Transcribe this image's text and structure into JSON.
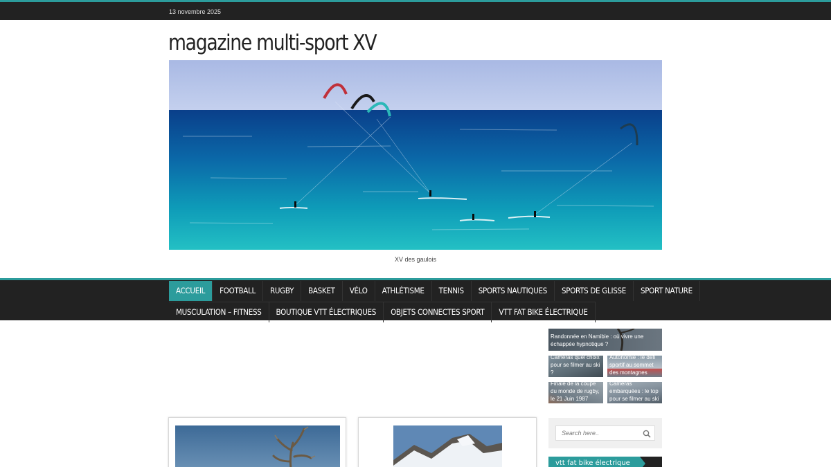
{
  "topbar": {
    "date": "13 novembre 2025"
  },
  "site": {
    "title": "magazine multi-sport XV",
    "hero_caption": "XV des gaulois"
  },
  "nav": {
    "row1": [
      "ACCUEIL",
      "FOOTBALL",
      "RUGBY",
      "BASKET",
      "VÉLO",
      "ATHLÉTISME",
      "TENNIS",
      "SPORTS NAUTIQUES",
      "SPORTS DE GLISSE",
      "SPORT NATURE"
    ],
    "row2": [
      "MUSCULATION – FITNESS",
      "BOUTIQUE VTT ÉLECTRIQUES",
      "OBJETS CONNECTES SPORT",
      "VTT FAT BIKE ÉLECTRIQUE"
    ],
    "active": "ACCUEIL"
  },
  "slider": {
    "main": "Randonnée en Namibie : où vivre une échappée hypnotique ?",
    "thumbs": [
      "Caméras quel choix pour se filmer au ski ?",
      "Autonomie : le défi sportif au sommet des montagnes",
      "Finale de la coupe du monde de rugby, le 21 Juin 1987",
      "Caméras embarquées : le top pour se filmer au ski"
    ]
  },
  "search": {
    "placeholder": "Search here.."
  },
  "widget": {
    "title": "vtt fat bike électrique"
  },
  "colors": {
    "accent": "#2c9c9c",
    "dark": "#222222"
  },
  "icons": {
    "search": "search-icon"
  }
}
